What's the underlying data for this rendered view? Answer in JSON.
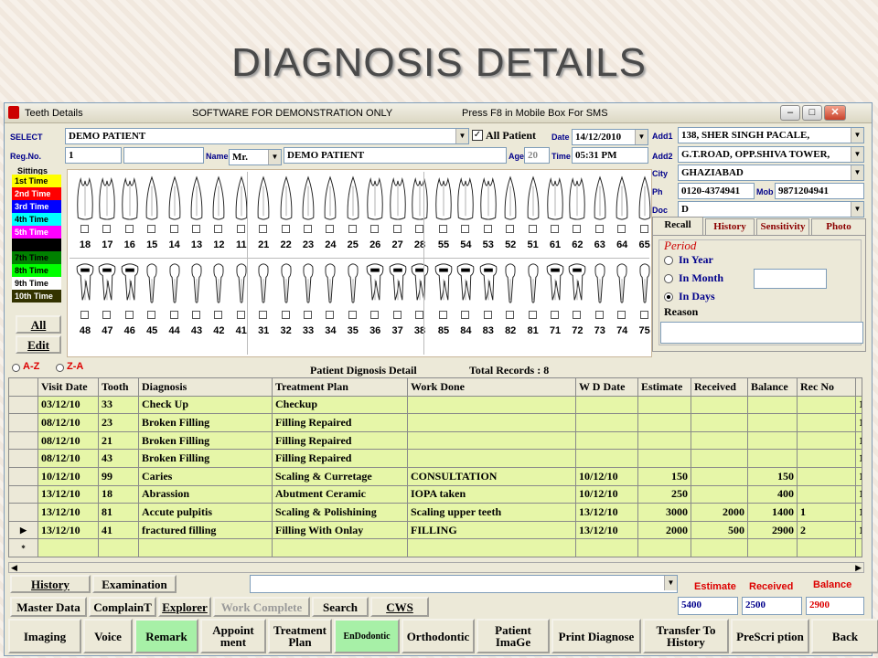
{
  "slide_title": "DIAGNOSIS DETAILS",
  "window": {
    "title": "Teeth Details",
    "notice": "SOFTWARE FOR DEMONSTRATION ONLY",
    "sms_hint": "Press F8 in Mobile Box For SMS"
  },
  "patient": {
    "select_label": "SELECT",
    "select_value": "DEMO PATIENT",
    "all_patient_label": "All Patient",
    "date_label": "Date",
    "date_value": "14/12/2010",
    "regno_label": "Reg.No.",
    "regno_value": "1",
    "name_label": "Name",
    "title_value": "Mr.",
    "name_value": "DEMO PATIENT",
    "age_label": "Age",
    "age_value": "20",
    "time_label": "Time",
    "time_value": "05:31 PM"
  },
  "address": {
    "add1_label": "Add1",
    "add1": "138, SHER SINGH PACALE,",
    "add2_label": "Add2",
    "add2": "G.T.ROAD, OPP.SHIVA TOWER,",
    "city_label": "City",
    "city": "GHAZIABAD",
    "ph_label": "Ph",
    "ph": "0120-4374941",
    "mob_label": "Mob",
    "mob": "9871204941",
    "doc_label": "Doc",
    "doc": "D"
  },
  "sittings": {
    "label": "Sittings",
    "items": [
      {
        "label": "1st Time",
        "bg": "#ffff00",
        "fg": "#000000"
      },
      {
        "label": "2nd Time",
        "bg": "#ff0000",
        "fg": "#ffffff"
      },
      {
        "label": "3rd Time",
        "bg": "#0000ff",
        "fg": "#ffffff"
      },
      {
        "label": "4th Time",
        "bg": "#00ffff",
        "fg": "#000000"
      },
      {
        "label": "5th Time",
        "bg": "#ff00ff",
        "fg": "#ffffff"
      },
      {
        "label": "",
        "bg": "#000000",
        "fg": "#ffffff"
      },
      {
        "label": "7th Time",
        "bg": "#008000",
        "fg": "#000000"
      },
      {
        "label": "8th Time",
        "bg": "#00ff00",
        "fg": "#000000"
      },
      {
        "label": "9th Time",
        "bg": "#ffffff",
        "fg": "#000000"
      },
      {
        "label": "10th Time",
        "bg": "#333300",
        "fg": "#ffffff"
      }
    ],
    "all": "All",
    "edit": "Edit"
  },
  "teeth": {
    "upper": [
      "18",
      "17",
      "16",
      "15",
      "14",
      "13",
      "12",
      "11",
      "21",
      "22",
      "23",
      "24",
      "25",
      "26",
      "27",
      "28",
      "55",
      "54",
      "53",
      "52",
      "51",
      "61",
      "62",
      "63",
      "64",
      "65"
    ],
    "lower": [
      "48",
      "47",
      "46",
      "45",
      "44",
      "43",
      "42",
      "41",
      "31",
      "32",
      "33",
      "34",
      "35",
      "36",
      "37",
      "38",
      "85",
      "84",
      "83",
      "82",
      "81",
      "71",
      "72",
      "73",
      "74",
      "75"
    ]
  },
  "tabs": [
    "Recall",
    "History",
    "Sensitivity",
    "Photo"
  ],
  "recall": {
    "period_label": "Period",
    "options": [
      "In Year",
      "In Month",
      "In Days"
    ],
    "selected": "In Days",
    "reason_label": "Reason"
  },
  "sort": {
    "az": "A-Z",
    "za": "Z-A"
  },
  "detail": {
    "title": "Patient Dignosis Detail",
    "total_label": "Total Records : 8"
  },
  "table": {
    "columns": [
      "Visit Date",
      "Tooth",
      "Diagnosis",
      "Treatment Plan",
      "Work Done",
      "W D Date",
      "Estimate",
      "Received",
      "Balance",
      "Rec No",
      ""
    ],
    "rows": [
      [
        "03/12/10",
        "33",
        "Check Up",
        "Checkup",
        "",
        "",
        "",
        "",
        "",
        "",
        "1"
      ],
      [
        "08/12/10",
        "23",
        "Broken Filling",
        "Filling Repaired",
        "",
        "",
        "",
        "",
        "",
        "",
        "1"
      ],
      [
        "08/12/10",
        "21",
        "Broken Filling",
        "Filling Repaired",
        "",
        "",
        "",
        "",
        "",
        "",
        "1"
      ],
      [
        "08/12/10",
        "43",
        "Broken Filling",
        "Filling Repaired",
        "",
        "",
        "",
        "",
        "",
        "",
        "1"
      ],
      [
        "10/12/10",
        "99",
        "Caries",
        "Scaling & Curretage",
        "CONSULTATION",
        "10/12/10",
        "150",
        "",
        "150",
        "",
        "1"
      ],
      [
        "13/12/10",
        "18",
        "Abrassion",
        "Abutment Ceramic",
        "IOPA taken",
        "10/12/10",
        "250",
        "",
        "400",
        "",
        "1"
      ],
      [
        "13/12/10",
        "81",
        "Accute pulpitis",
        "Scaling & Polishining",
        "Scaling upper teeth",
        "13/12/10",
        "3000",
        "2000",
        "1400",
        "1",
        "1"
      ],
      [
        "13/12/10",
        "41",
        "fractured filling",
        "Filling With Onlay",
        "FILLING",
        "13/12/10",
        "2000",
        "500",
        "2900",
        "2",
        "1"
      ]
    ],
    "current_marker": "▶",
    "new_marker": "*"
  },
  "buttons1": {
    "history": "History",
    "examination": "Examination"
  },
  "buttons2": {
    "master": "Master Data",
    "complaint": "ComplainT",
    "explorer": "Explorer",
    "work_complete": "Work Complete",
    "search": "Search",
    "cws": "CWS"
  },
  "totals": {
    "estimate_label": "Estimate",
    "received_label": "Received",
    "balance_label": "Balance",
    "estimate": "5400",
    "received": "2500",
    "balance": "2900"
  },
  "buttons3": [
    "Imaging",
    "Voice",
    "Remark",
    "Appoint ment",
    "Treatment Plan",
    "EnDodontic",
    "Orthodontic",
    "Patient ImaGe",
    "Print Diagnose",
    "Transfer To History",
    "PreScri ption",
    "Back"
  ]
}
